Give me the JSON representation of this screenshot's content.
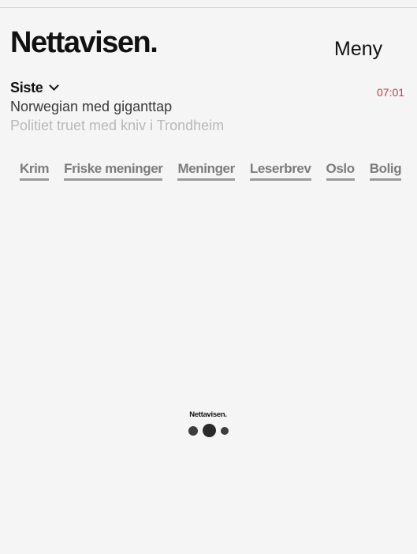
{
  "header": {
    "logo": "Nettavisen.",
    "menu_label": "Meny"
  },
  "latest": {
    "label": "Siste",
    "time": "07:01",
    "headlines": [
      "Norwegian med giganttap",
      "Politiet truet med kniv i Trondheim"
    ]
  },
  "categories": [
    "Krim",
    "Friske meninger",
    "Meninger",
    "Leserbrev",
    "Oslo",
    "Bolig"
  ],
  "loader": {
    "logo": "Nettavisen."
  },
  "colors": {
    "background": "#f5f5f5",
    "time_accent": "#d6334d",
    "category_text": "#7c7c7c"
  }
}
